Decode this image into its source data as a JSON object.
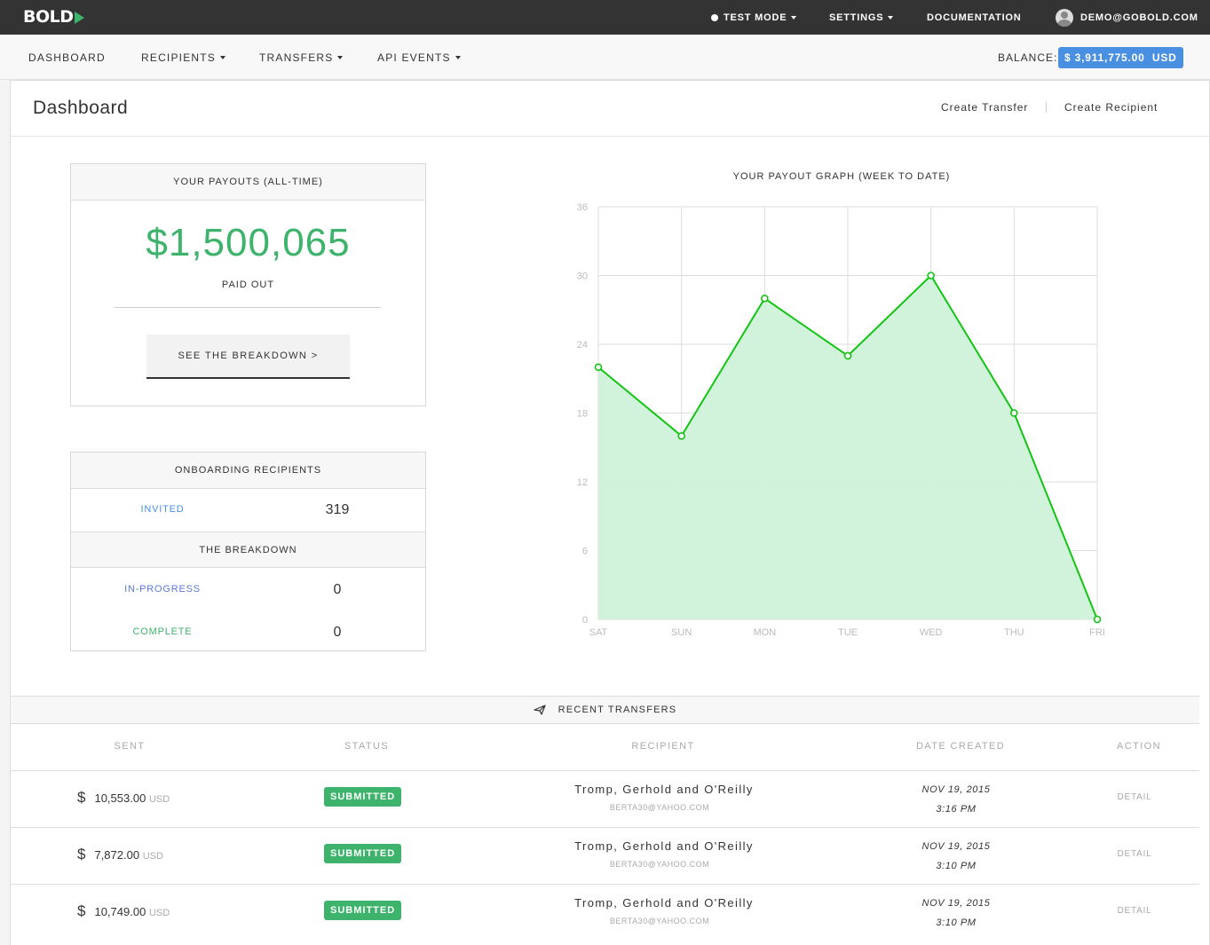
{
  "topbar": {
    "logo": "BOLD",
    "test_mode": "TEST MODE",
    "settings": "SETTINGS",
    "documentation": "DOCUMENTATION",
    "user_email": "DEMO@GOBOLD.COM"
  },
  "subnav": {
    "items": [
      "DASHBOARD",
      "RECIPIENTS",
      "TRANSFERS",
      "API EVENTS"
    ],
    "balance_label": "BALANCE:",
    "balance_value": "$ 3,911,775.00  USD"
  },
  "page": {
    "title": "Dashboard",
    "create_transfer": "Create Transfer",
    "create_recipient": "Create Recipient"
  },
  "payouts": {
    "heading": "YOUR PAYOUTS (ALL-TIME)",
    "amount": "$1,500,065",
    "caption": "PAID OUT",
    "button": "SEE THE BREAKDOWN >"
  },
  "onboarding": {
    "heading": "ONBOARDING RECIPIENTS",
    "invited_label": "INVITED",
    "invited_value": "319",
    "breakdown_heading": "THE BREAKDOWN",
    "in_progress_label": "IN-PROGRESS",
    "in_progress_value": "0",
    "complete_label": "COMPLETE",
    "complete_value": "0"
  },
  "chart_data": {
    "type": "area",
    "title": "YOUR PAYOUT GRAPH (WEEK TO DATE)",
    "categories": [
      "SAT",
      "SUN",
      "MON",
      "TUE",
      "WED",
      "THU",
      "FRI"
    ],
    "values": [
      22,
      16,
      28,
      23,
      30,
      18,
      0
    ],
    "ylim": [
      0,
      36
    ],
    "yticks": [
      0,
      6,
      12,
      18,
      24,
      30,
      36
    ],
    "grid": true,
    "line_color": "#13c413",
    "fill_color": "#cff2d9"
  },
  "transfers": {
    "heading": "RECENT TRANSFERS",
    "columns": [
      "SENT",
      "STATUS",
      "RECIPIENT",
      "DATE CREATED",
      "ACTION"
    ],
    "rows": [
      {
        "amount": "10,553.00",
        "currency": "USD",
        "status": "SUBMITTED",
        "recipient": "Tromp, Gerhold and O'Reilly",
        "email": "BERTA30@YAHOO.COM",
        "date": "NOV 19, 2015",
        "time": "3:16 PM",
        "action": "DETAIL"
      },
      {
        "amount": "7,872.00",
        "currency": "USD",
        "status": "SUBMITTED",
        "recipient": "Tromp, Gerhold and O'Reilly",
        "email": "BERTA30@YAHOO.COM",
        "date": "NOV 19, 2015",
        "time": "3:10 PM",
        "action": "DETAIL"
      },
      {
        "amount": "10,749.00",
        "currency": "USD",
        "status": "SUBMITTED",
        "recipient": "Tromp, Gerhold and O'Reilly",
        "email": "BERTA30@YAHOO.COM",
        "date": "NOV 19, 2015",
        "time": "3:10 PM",
        "action": "DETAIL"
      }
    ]
  },
  "colors": {
    "accent_green": "#3db36b",
    "accent_blue": "#4a90e2",
    "topbar": "#333333"
  }
}
